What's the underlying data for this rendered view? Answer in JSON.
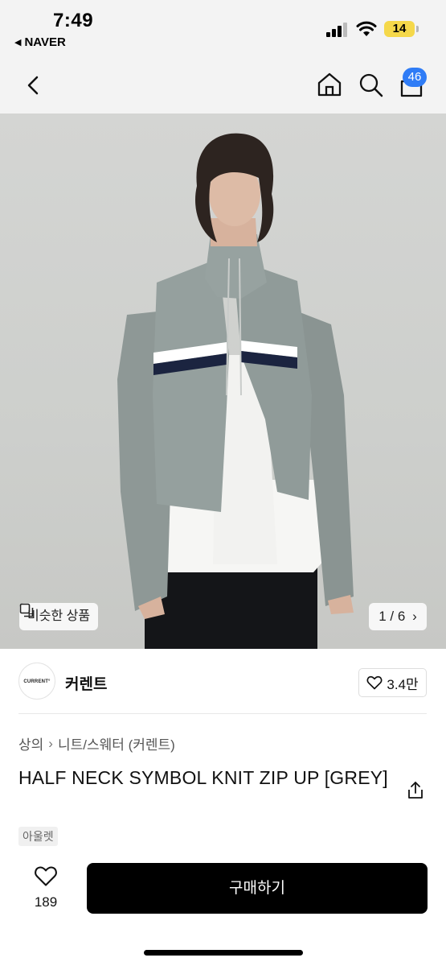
{
  "status_bar": {
    "time": "7:49",
    "back_app": "NAVER",
    "battery": "14",
    "battery_color": "#f5d84a"
  },
  "nav": {
    "back_icon": "chevron-left-icon",
    "home_icon": "home-icon",
    "search_icon": "search-icon",
    "bag_icon": "shopping-bag-icon",
    "cart_count": "46",
    "badge_color": "#2f7cf6"
  },
  "hero": {
    "similar_label": "비슷한 상품",
    "pager": "1 / 6"
  },
  "brand": {
    "logo_text": "CURRENT°",
    "name": "커렌트",
    "likes": "3.4만"
  },
  "breadcrumb": {
    "category": "상의",
    "subcategory": "니트/스웨터 (커렌트)"
  },
  "product": {
    "title": "HALF NECK SYMBOL KNIT ZIP UP [GREY]",
    "tag": "아울렛"
  },
  "bottom_bar": {
    "wish_count": "189",
    "buy_label": "구매하기"
  }
}
